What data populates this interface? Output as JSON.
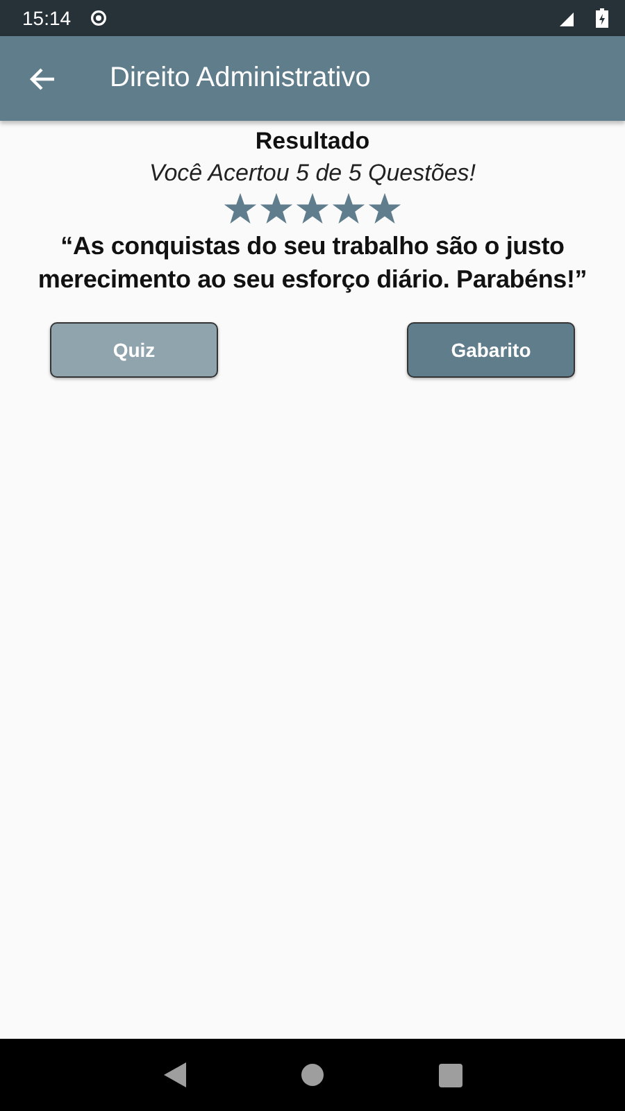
{
  "status_bar": {
    "time": "15:14"
  },
  "app_bar": {
    "title": "Direito Administrativo"
  },
  "result": {
    "heading": "Resultado",
    "score": "Você Acertou 5 de 5 Questões!",
    "stars": 5,
    "message": "“As conquistas do seu trabalho são o justo merecimento ao seu esforço diário. Parabéns!”"
  },
  "buttons": [
    {
      "label": "Quiz",
      "kind": "light"
    },
    {
      "label": "Gabarito",
      "kind": "dark"
    }
  ]
}
